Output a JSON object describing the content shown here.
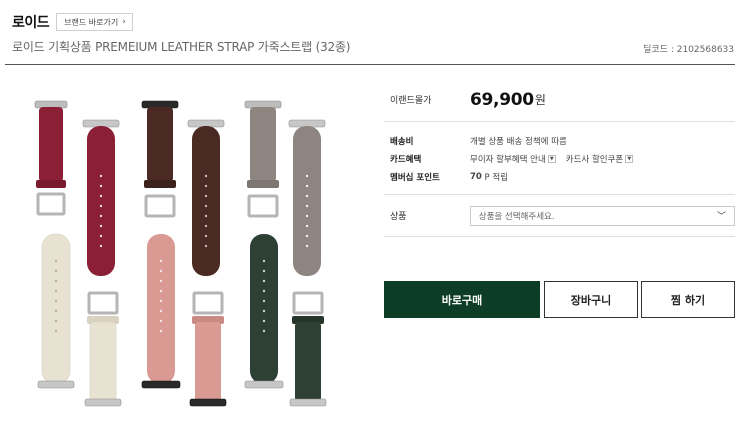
{
  "brand": {
    "name": "로이드",
    "link_label": "브랜드 바로가기",
    "link_icon": "chevron-right-icon"
  },
  "product": {
    "title": "로이드 기획상품 PREMEIUM LEATHER STRAP 가죽스트랩 (32종)",
    "item_code": "딜코드 : 2102568633"
  },
  "image": {
    "alt_subject": "leather-watch-straps",
    "colors": {
      "burgundy": "#8a1f36",
      "brown": "#4a2a22",
      "taupe": "#8e8580",
      "ivory": "#e8e2d3",
      "pink": "#d99a94",
      "green": "#2e3f33"
    }
  },
  "price": {
    "label": "이랜드몰가",
    "value": "69,900",
    "unit": "원"
  },
  "details": {
    "shipping": {
      "label": "배송비",
      "value": "개별 상품 배송 정책에 따름"
    },
    "card": {
      "label": "카드혜택",
      "interest_free": "무이자 할부혜택 안내",
      "card_coupon": "카드사 할인쿠폰"
    },
    "points": {
      "label": "멤버십 포인트",
      "value": "70",
      "unit": "P 적립"
    }
  },
  "option": {
    "label": "상품",
    "placeholder": "상품을 선택해주세요.",
    "icon": "chevron-down-icon"
  },
  "actions": {
    "buy": "바로구매",
    "cart": "장바구니",
    "wish": "찜 하기"
  },
  "theme": {
    "accent": "#0d3d24"
  }
}
